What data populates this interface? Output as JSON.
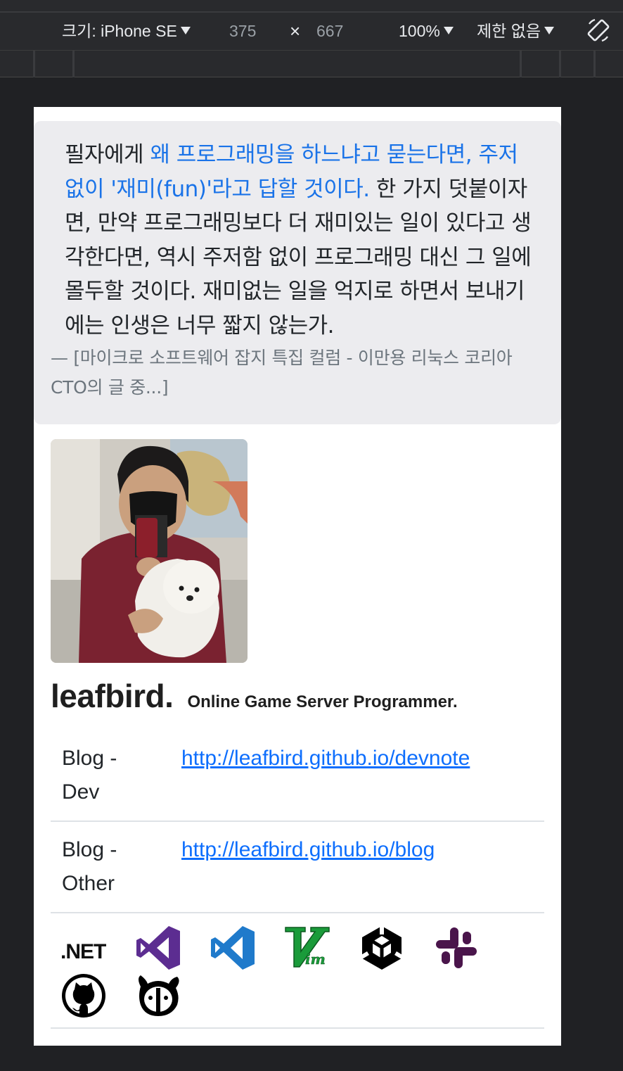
{
  "devtools": {
    "size_label": "크기: iPhone SE",
    "width": "375",
    "times": "×",
    "height": "667",
    "zoom": "100%",
    "throttle": "제한 없음",
    "icons": [
      "chevron-down-icon",
      "rotate-icon"
    ]
  },
  "quote": {
    "text_before": "필자에게 ",
    "text_highlight": "왜 프로그래밍을 하느냐고 묻는다면, 주저없이 '재미(fun)'라고 답할 것이다.",
    "text_after": " 한 가지 덧붙이자면, 만약 프로그래밍보다 더 재미있는 일이 있다고 생각한다면, 역시 주저함 없이 프로그래밍 대신 그 일에 몰두할 것이다. 재미없는 일을 억지로 하면서 보내기에는 인생은 너무 짧지 않는가.",
    "source": "—  [마이크로 소프트웨어 잡지 특집 컬럼 - 이만용 리눅스 코리아 CTO의 글 중...]"
  },
  "profile": {
    "name": "leafbird.",
    "tagline": "Online Game Server Programmer."
  },
  "links": [
    {
      "label": "Blog - Dev",
      "url": "http://leafbird.github.io/devnote"
    },
    {
      "label": "Blog - Other",
      "url": "http://leafbird.github.io/blog"
    }
  ],
  "tools": {
    "dotnet_label": ".NET",
    "icons": [
      "dotnet-icon",
      "visual-studio-icon",
      "vscode-icon",
      "vim-icon",
      "unity-icon",
      "slack-icon",
      "github-icon",
      "bear-logo-icon"
    ]
  },
  "colors": {
    "accent_link": "#0d6efd",
    "quote_highlight": "#1a73e8",
    "quote_bg": "#ececef",
    "visual_studio": "#5c2d91",
    "vscode": "#1f7acb",
    "vim": "#1a9b3a",
    "slack": "#4a154b"
  }
}
